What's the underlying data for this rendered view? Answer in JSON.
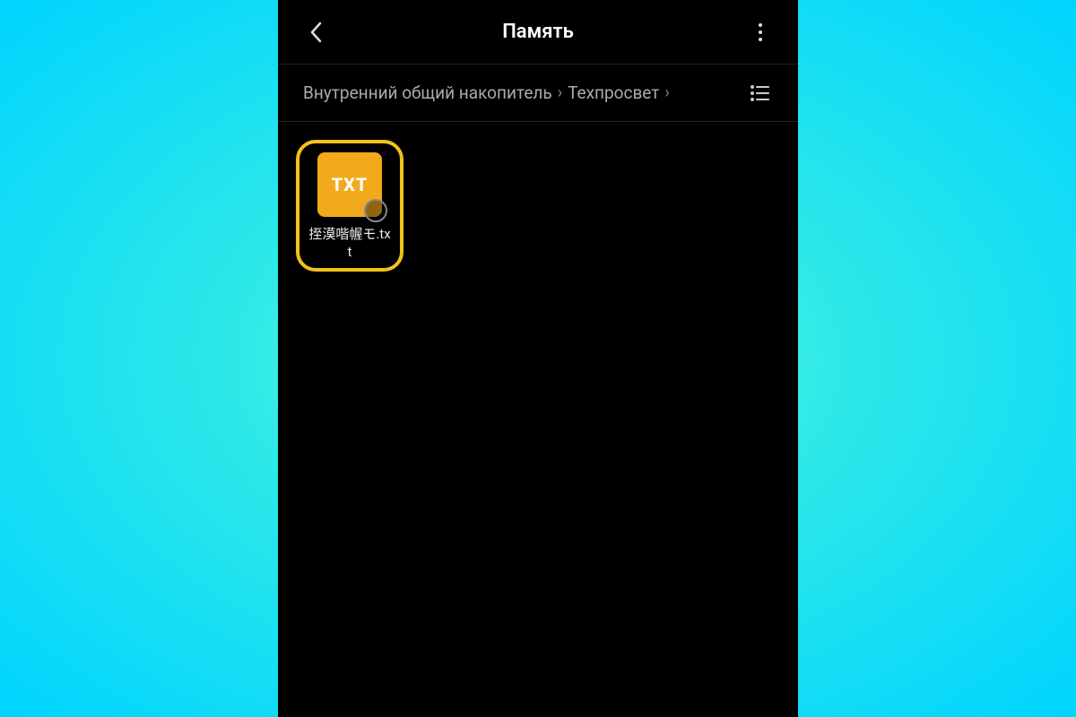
{
  "header": {
    "title": "Память"
  },
  "breadcrumb": {
    "segments": [
      "Внутренний общий накопитель",
      "Техпросвет"
    ]
  },
  "files": [
    {
      "badge": "TXT",
      "name": "挃漠喈幄モ.txt"
    }
  ],
  "colors": {
    "highlight": "#f2c21a",
    "thumb": "#f2a91c"
  }
}
